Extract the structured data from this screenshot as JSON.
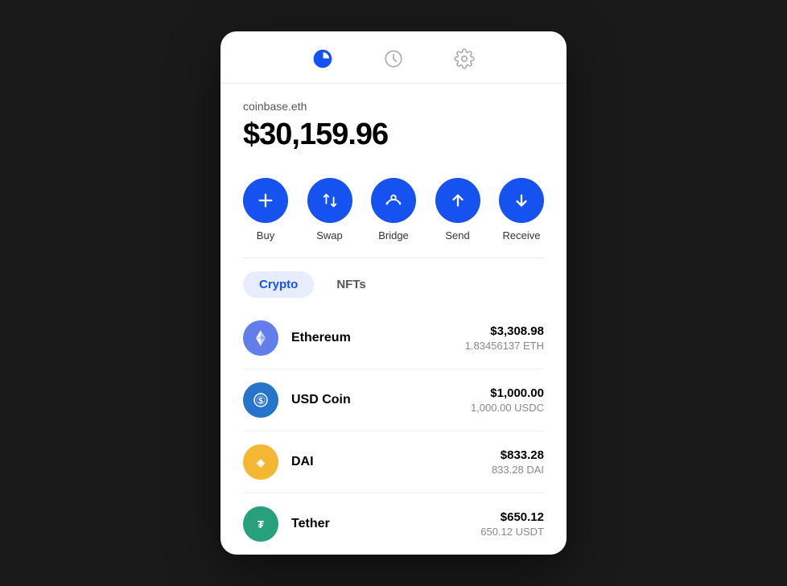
{
  "nav": {
    "portfolio_icon": "portfolio",
    "history_icon": "history",
    "settings_icon": "settings"
  },
  "wallet": {
    "name": "coinbase.eth",
    "balance": "$30,159.96"
  },
  "actions": [
    {
      "id": "buy",
      "label": "Buy",
      "icon": "plus"
    },
    {
      "id": "swap",
      "label": "Swap",
      "icon": "swap"
    },
    {
      "id": "bridge",
      "label": "Bridge",
      "icon": "bridge"
    },
    {
      "id": "send",
      "label": "Send",
      "icon": "send"
    },
    {
      "id": "receive",
      "label": "Receive",
      "icon": "receive"
    }
  ],
  "tabs": [
    {
      "id": "crypto",
      "label": "Crypto",
      "active": true
    },
    {
      "id": "nfts",
      "label": "NFTs",
      "active": false
    }
  ],
  "assets": [
    {
      "id": "eth",
      "name": "Ethereum",
      "usd_value": "$3,308.98",
      "crypto_value": "1.83456137 ETH",
      "color": "#627eea"
    },
    {
      "id": "usdc",
      "name": "USD Coin",
      "usd_value": "$1,000.00",
      "crypto_value": "1,000.00 USDC",
      "color": "#2775ca"
    },
    {
      "id": "dai",
      "name": "DAI",
      "usd_value": "$833.28",
      "crypto_value": "833.28 DAI",
      "color": "#f4b731"
    },
    {
      "id": "usdt",
      "name": "Tether",
      "usd_value": "$650.12",
      "crypto_value": "650.12 USDT",
      "color": "#26a17b"
    }
  ],
  "accent_color": "#1652f0"
}
